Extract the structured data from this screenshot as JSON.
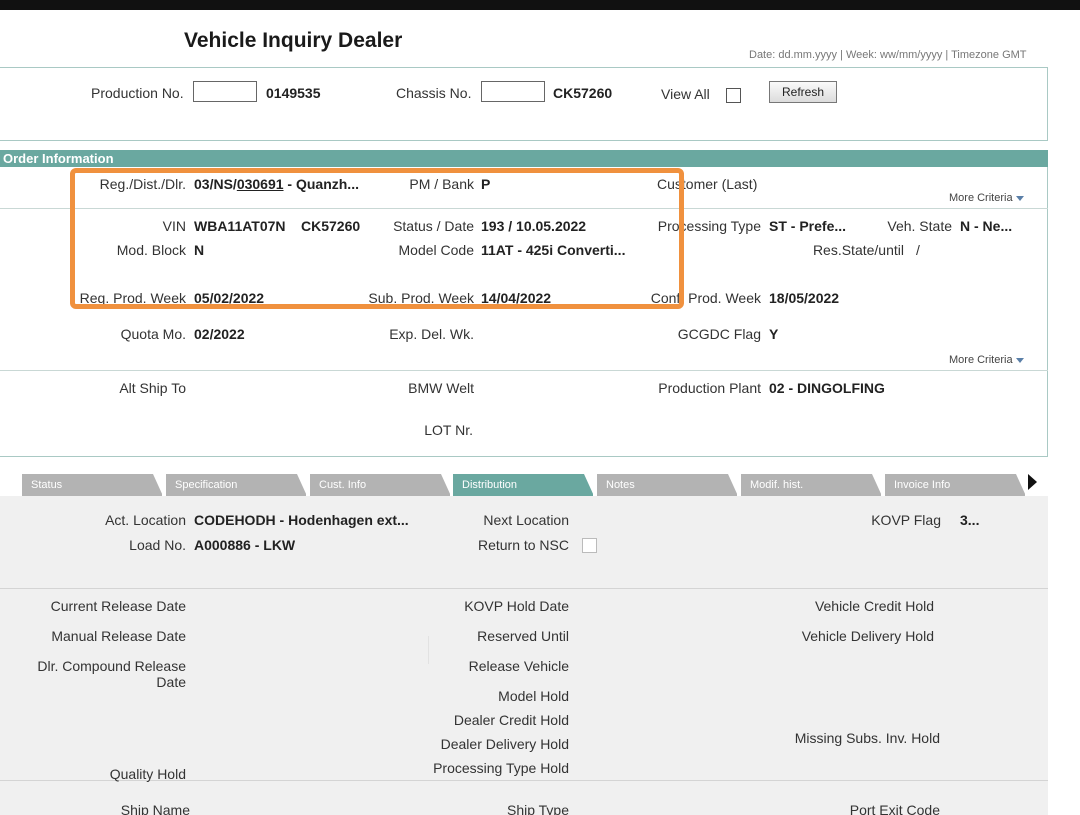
{
  "page": {
    "title": "Vehicle Inquiry Dealer",
    "date_hint": "Date: dd.mm.yyyy | Week: ww/mm/yyyy | Timezone GMT"
  },
  "search": {
    "production_label": "Production No.",
    "production_input": "",
    "production_value": "0149535",
    "chassis_label": "Chassis No.",
    "chassis_input": "",
    "chassis_value": "CK57260",
    "view_all_label": "View All",
    "view_all_checked": false,
    "refresh_label": "Refresh"
  },
  "order": {
    "header": "Order Information",
    "reg_label": "Reg./Dist./Dlr.",
    "reg_prefix": "03/NS/",
    "reg_link": "030691",
    "reg_suffix": " - Quanzh...",
    "pm_label": "PM / Bank",
    "pm_value": "P",
    "customer_label": "Customer (Last)",
    "more_criteria_1": "More Criteria",
    "vin_label": "VIN",
    "vin_value": "WBA11AT07N",
    "vin_chassis": "CK57260",
    "status_label": "Status / Date",
    "status_value": "193 /  10.05.2022",
    "ptype_label": "Processing Type",
    "ptype_value": "ST - Prefe...",
    "vstate_label": "Veh. State",
    "vstate_value": "N - Ne...",
    "modblock_label": "Mod. Block",
    "modblock_value": "N",
    "model_label": "Model Code",
    "model_value": "11AT - 425i Converti...",
    "resstate_label": "Res.State/until",
    "resstate_value": "/",
    "regprod_label": "Req. Prod. Week",
    "regprod_value": "05/02/2022",
    "subprod_label": "Sub. Prod. Week",
    "subprod_value": "14/04/2022",
    "confprod_label": "Conf. Prod. Week",
    "confprod_value": "18/05/2022",
    "quota_label": "Quota Mo.",
    "quota_value": "02/2022",
    "expdel_label": "Exp. Del. Wk.",
    "gcgdc_label": "GCGDC Flag",
    "gcgdc_value": "Y",
    "more_criteria_2": "More Criteria",
    "altship_label": "Alt Ship To",
    "bmwwelt_label": "BMW Welt",
    "plant_label": "Production Plant",
    "plant_value": "02 - DINGOLFING",
    "lot_label": "LOT Nr."
  },
  "tabs": [
    {
      "label": "Status"
    },
    {
      "label": "Specification"
    },
    {
      "label": "Cust. Info"
    },
    {
      "label": "Distribution"
    },
    {
      "label": "Notes"
    },
    {
      "label": "Modif. hist."
    },
    {
      "label": "Invoice Info"
    }
  ],
  "active_tab": "Distribution",
  "distribution": {
    "act_location_label": "Act. Location",
    "act_location_value": "CODEHODH - Hodenhagen ext...",
    "next_location_label": "Next Location",
    "kovp_flag_label": "KOVP Flag",
    "kovp_flag_value": "3...",
    "load_label": "Load No.",
    "load_value": "A000886 - LKW",
    "return_nsc_label": "Return to NSC",
    "return_nsc_checked": false,
    "current_release_label": "Current Release Date",
    "kovp_hold_label": "KOVP Hold Date",
    "credit_hold_label": "Vehicle Credit Hold",
    "manual_release_label": "Manual Release Date",
    "reserved_label": "Reserved Until",
    "delivery_hold_label": "Vehicle Delivery Hold",
    "dlr_compound_label_1": "Dlr. Compound Release",
    "dlr_compound_label_2": "Date",
    "release_vehicle_label": "Release Vehicle",
    "model_hold_label": "Model Hold",
    "dealer_credit_label": "Dealer Credit Hold",
    "dealer_delivery_label": "Dealer Delivery Hold",
    "missing_subs_label": "Missing Subs. Inv. Hold",
    "quality_hold_label": "Quality Hold",
    "ptype_hold_label": "Processing Type Hold",
    "ship_name_label": "Ship Name",
    "ship_type_label": "Ship Type",
    "port_exit_label": "Port Exit Code"
  },
  "colors": {
    "accent_teal": "#6aa8a0",
    "highlight_orange": "#f0913e",
    "tab_inactive": "#b3b3b3"
  }
}
